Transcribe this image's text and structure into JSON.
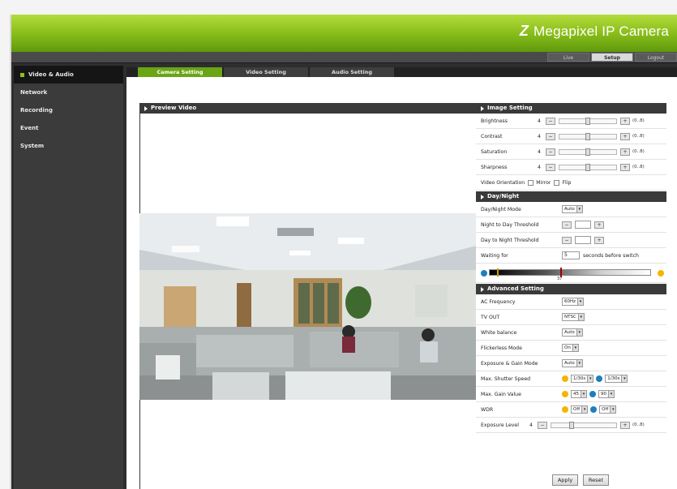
{
  "header": {
    "brand_mark": "Z",
    "title": "Megapixel IP Camera"
  },
  "topnav": {
    "tabs": [
      "Live",
      "Setup",
      "Logout"
    ],
    "active_index": 1
  },
  "sidebar": {
    "items": [
      {
        "label": "Video & Audio",
        "active": true
      },
      {
        "label": "Network",
        "active": false
      },
      {
        "label": "Recording",
        "active": false
      },
      {
        "label": "Event",
        "active": false
      },
      {
        "label": "System",
        "active": false
      }
    ]
  },
  "tabs": {
    "camera": "Camera Setting",
    "video": "Video Setting",
    "audio": "Audio Setting"
  },
  "preview": {
    "title": "Preview Video"
  },
  "image_setting": {
    "title": "Image Setting",
    "brightness": {
      "label": "Brightness",
      "value": "4",
      "range": "(0..8)",
      "level": 0.5
    },
    "contrast": {
      "label": "Contrast",
      "value": "4",
      "range": "(0..8)",
      "level": 0.5
    },
    "saturation": {
      "label": "Saturation",
      "value": "4",
      "range": "(0..8)",
      "level": 0.5
    },
    "sharpness": {
      "label": "Sharpness",
      "value": "4",
      "range": "(0..8)",
      "level": 0.5
    },
    "orientation": {
      "label": "Video Orientation",
      "mirror": "Mirror",
      "flip": "Flip"
    }
  },
  "day_night": {
    "title": "Day/Night",
    "mode": {
      "label": "Day/Night Mode",
      "value": "Auto"
    },
    "n2d": {
      "label": "Night to Day Threshold",
      "value": ""
    },
    "d2n": {
      "label": "Day to Night Threshold",
      "value": ""
    },
    "waiting": {
      "label": "Waiting for",
      "value": "5",
      "suffix": "seconds before switch"
    },
    "scale_value": "37"
  },
  "advanced": {
    "title": "Advanced Setting",
    "ac_frequency": {
      "label": "AC Frequency",
      "value": "60Hz"
    },
    "tv_out": {
      "label": "TV OUT",
      "value": "NTSC"
    },
    "white_balance": {
      "label": "White balance",
      "value": "Auto"
    },
    "flickerless": {
      "label": "Flickerless Mode",
      "value": "On"
    },
    "exposure_gain": {
      "label": "Exposure & Gain Mode",
      "value": "Auto"
    },
    "shutter": {
      "label": "Max. Shutter Speed",
      "day": "1/30s",
      "night": "1/30s"
    },
    "gain": {
      "label": "Max. Gain Value",
      "day": "45",
      "night": "90"
    },
    "wdr": {
      "label": "WDR",
      "day": "Off",
      "night": "Off"
    },
    "exposure_level": {
      "label": "Exposure Level",
      "value": "4",
      "range": "(0..8)",
      "level": 0.3
    }
  },
  "actions": {
    "apply": "Apply",
    "reset": "Reset"
  },
  "colors": {
    "accent": "#8ec11d",
    "dark": "#2e2e2e",
    "panel": "#3a3a3a"
  }
}
